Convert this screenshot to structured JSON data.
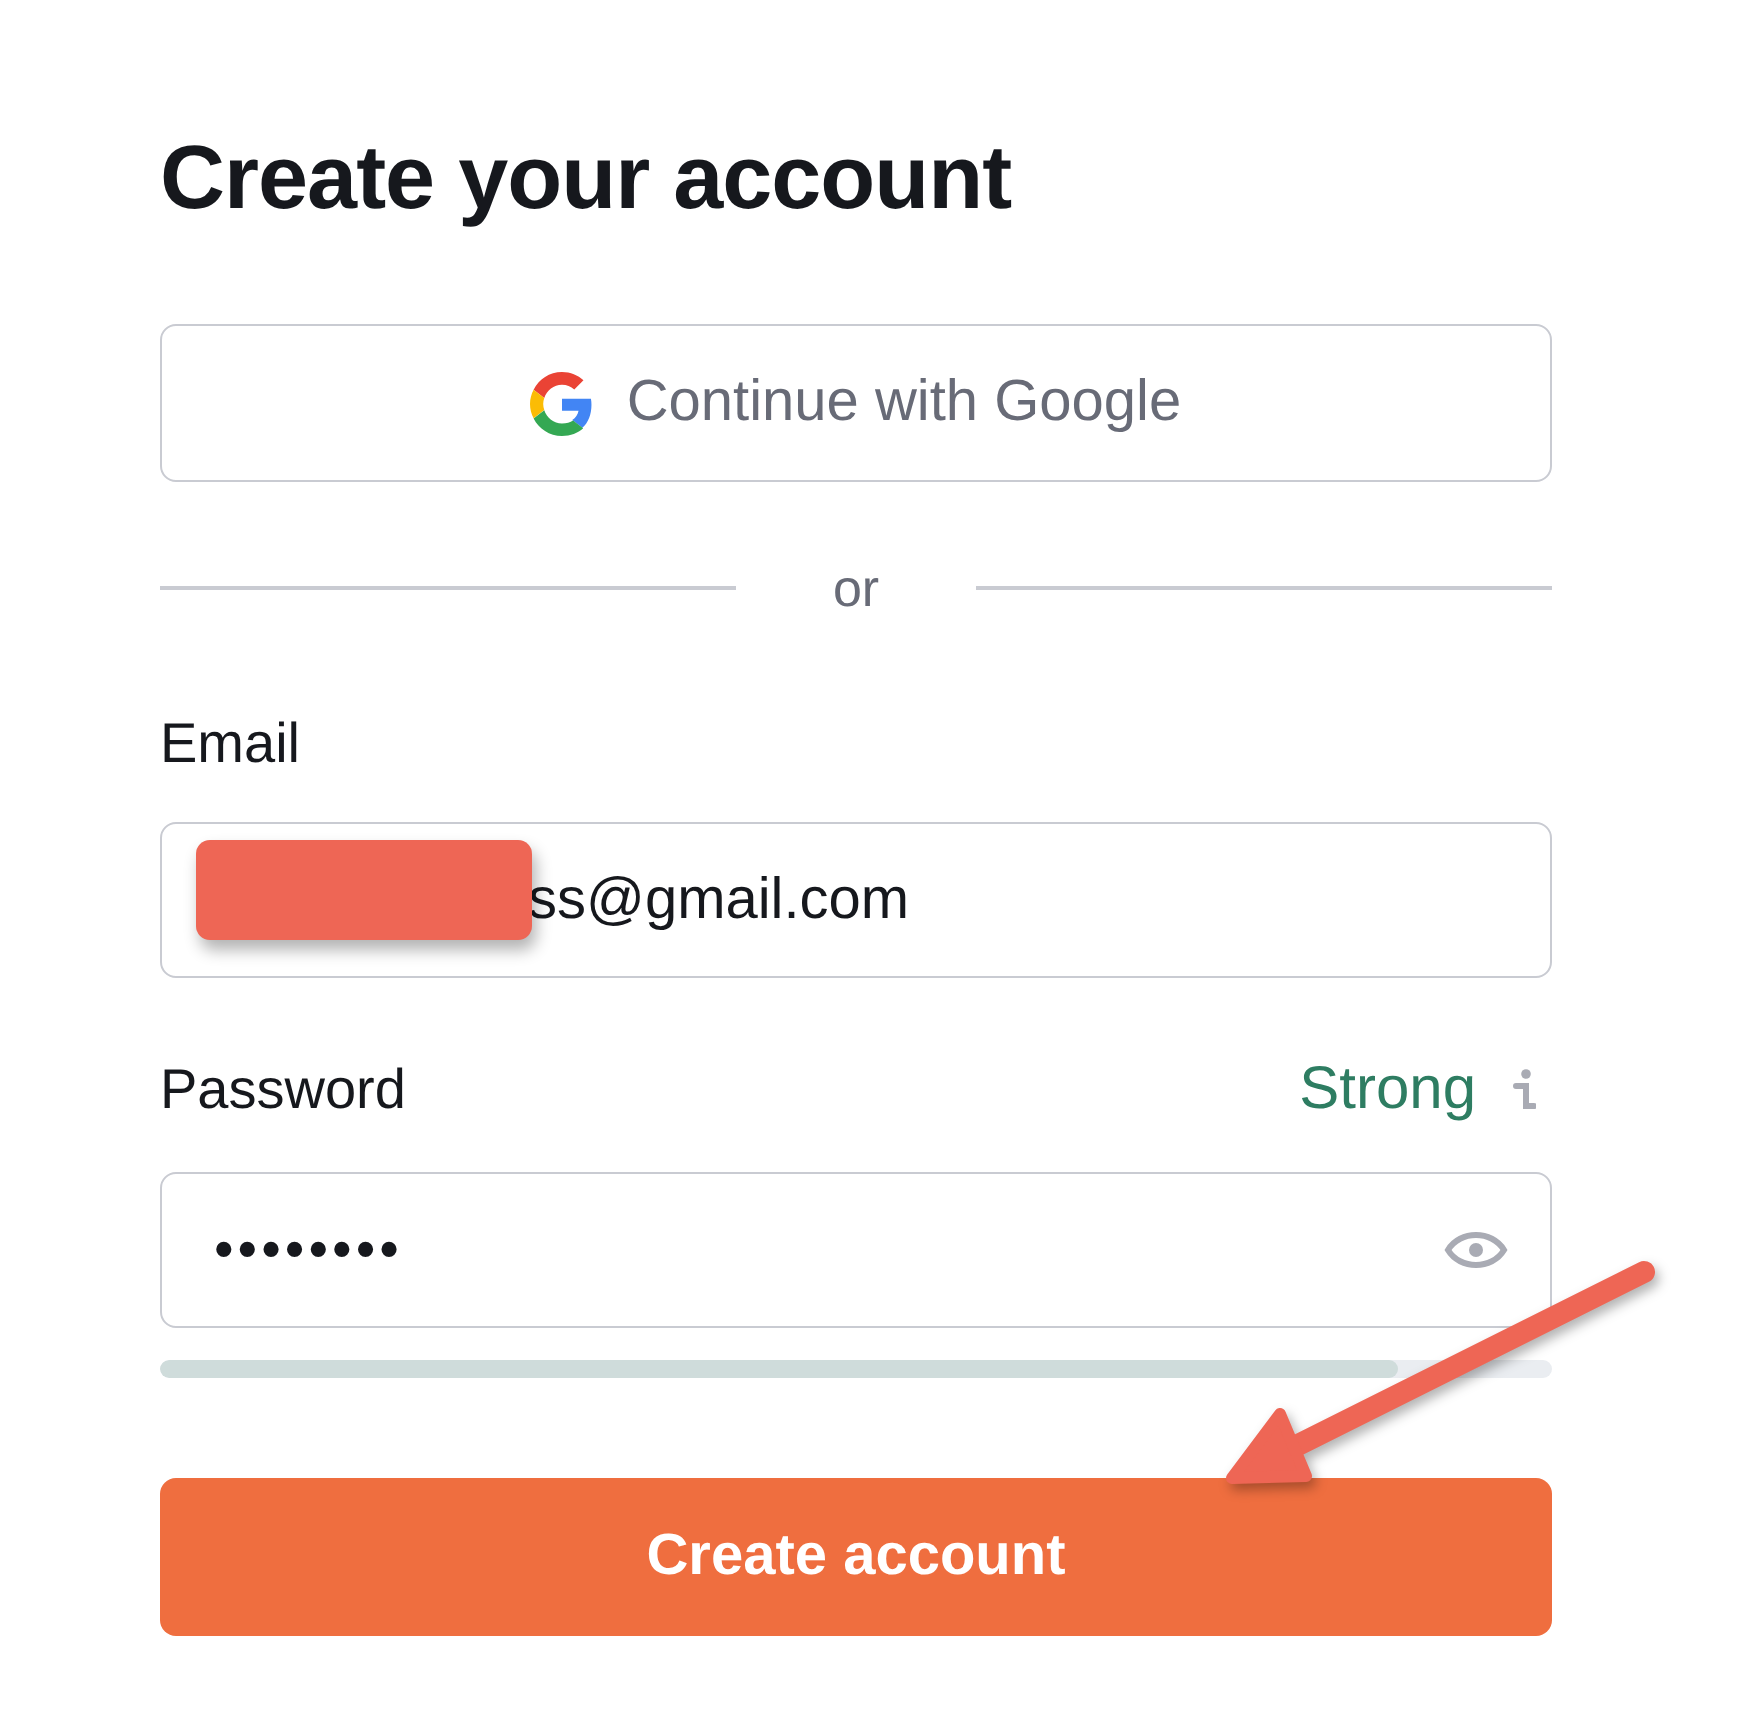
{
  "title": "Create your account",
  "google_button": {
    "label": "Continue with Google"
  },
  "divider": {
    "label": "or"
  },
  "email": {
    "label": "Email",
    "value": "ss@gmail.com"
  },
  "password": {
    "label": "Password",
    "strength": "Strong",
    "value": "••••••••",
    "strength_meter": {
      "level": 0.89
    }
  },
  "submit_button": {
    "label": "Create account"
  }
}
